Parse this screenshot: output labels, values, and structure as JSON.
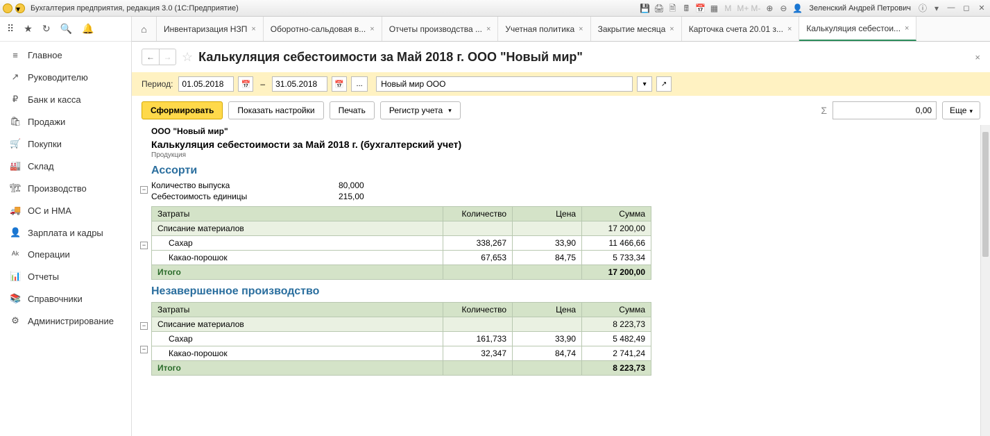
{
  "window": {
    "title": "Бухгалтерия предприятия, редакция 3.0  (1С:Предприятие)",
    "user": "Зеленский Андрей Петрович"
  },
  "nav": {
    "items": [
      {
        "icon": "≡",
        "label": "Главное"
      },
      {
        "icon": "↗",
        "label": "Руководителю"
      },
      {
        "icon": "₽",
        "label": "Банк и касса"
      },
      {
        "icon": "🛍",
        "label": "Продажи"
      },
      {
        "icon": "🛒",
        "label": "Покупки"
      },
      {
        "icon": "🏭",
        "label": "Склад"
      },
      {
        "icon": "🏗",
        "label": "Производство"
      },
      {
        "icon": "🚚",
        "label": "ОС и НМА"
      },
      {
        "icon": "👤",
        "label": "Зарплата и кадры"
      },
      {
        "icon": "ᴬᵏ",
        "label": "Операции"
      },
      {
        "icon": "📊",
        "label": "Отчеты"
      },
      {
        "icon": "📚",
        "label": "Справочники"
      },
      {
        "icon": "⚙",
        "label": "Администрирование"
      }
    ]
  },
  "tabs": [
    {
      "label": "Инвентаризация НЗП"
    },
    {
      "label": "Оборотно-сальдовая в..."
    },
    {
      "label": "Отчеты производства ..."
    },
    {
      "label": "Учетная политика"
    },
    {
      "label": "Закрытие месяца"
    },
    {
      "label": "Карточка счета 20.01 з..."
    },
    {
      "label": "Калькуляция себестои...",
      "active": true
    }
  ],
  "doc": {
    "title": "Калькуляция себестоимости за Май 2018 г. ООО \"Новый мир\"",
    "close": "×"
  },
  "params": {
    "period_label": "Период:",
    "date_from": "01.05.2018",
    "date_to": "31.05.2018",
    "dash": "–",
    "ellipsis": "...",
    "org": "Новый мир ООО"
  },
  "actions": {
    "form": "Сформировать",
    "show_settings": "Показать настройки",
    "print": "Печать",
    "register": "Регистр учета",
    "sum": "0,00",
    "more": "Еще"
  },
  "report": {
    "org": "ООО \"Новый мир\"",
    "title": "Калькуляция себестоимости за Май 2018 г. (бухгалтерский учет)",
    "subtype": "Продукция",
    "sections": [
      {
        "heading": "Ассорти",
        "kv": [
          {
            "label": "Количество выпуска",
            "value": "80,000"
          },
          {
            "label": "Себестоимость единицы",
            "value": "215,00"
          }
        ],
        "headers": {
          "costs": "Затраты",
          "qty": "Количество",
          "price": "Цена",
          "sum": "Сумма"
        },
        "group": {
          "name": "Списание материалов",
          "sum": "17 200,00"
        },
        "rows": [
          {
            "name": "Сахар",
            "qty": "338,267",
            "price": "33,90",
            "sum": "11 466,66"
          },
          {
            "name": "Какао-порошок",
            "qty": "67,653",
            "price": "84,75",
            "sum": "5 733,34"
          }
        ],
        "total": {
          "label": "Итого",
          "sum": "17 200,00"
        }
      },
      {
        "heading": "Незавершенное производство",
        "kv": [],
        "headers": {
          "costs": "Затраты",
          "qty": "Количество",
          "price": "Цена",
          "sum": "Сумма"
        },
        "group": {
          "name": "Списание материалов",
          "sum": "8 223,73"
        },
        "rows": [
          {
            "name": "Сахар",
            "qty": "161,733",
            "price": "33,90",
            "sum": "5 482,49"
          },
          {
            "name": "Какао-порошок",
            "qty": "32,347",
            "price": "84,74",
            "sum": "2 741,24"
          }
        ],
        "total": {
          "label": "Итого",
          "sum": "8 223,73"
        }
      }
    ]
  }
}
